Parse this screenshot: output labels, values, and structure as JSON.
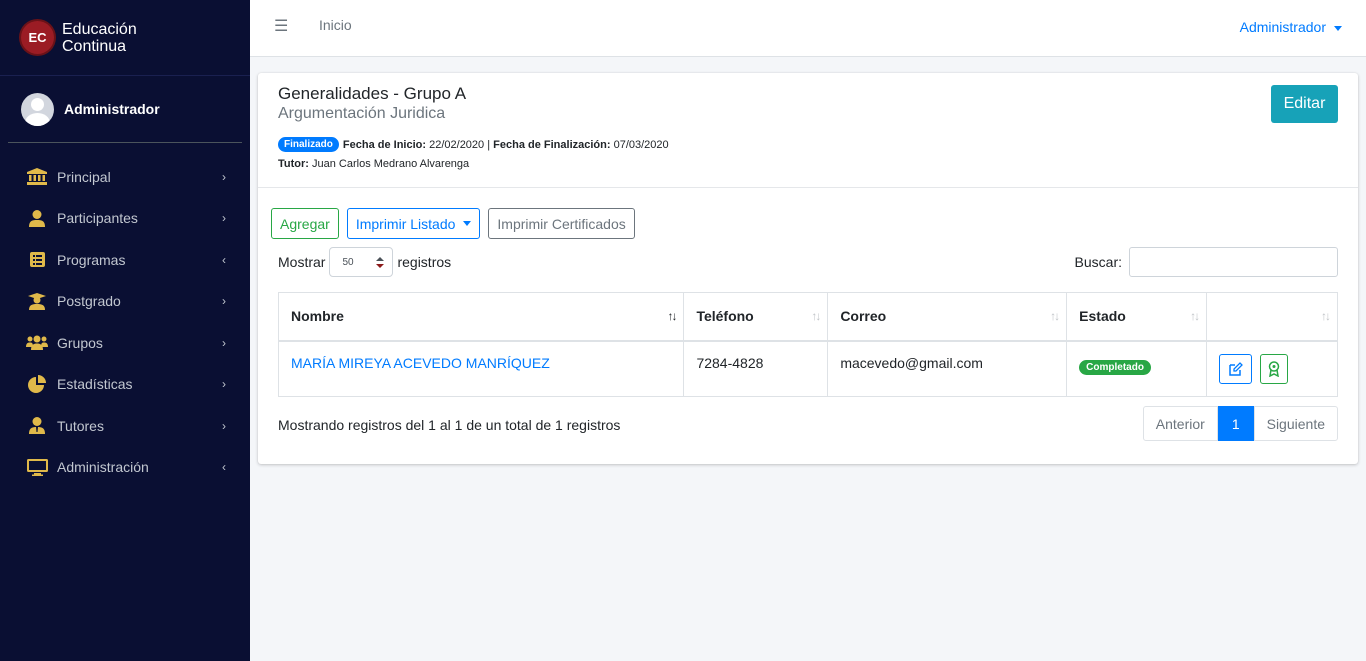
{
  "brand": {
    "logo_text": "EC",
    "line1": "Educación",
    "line2": "Continua"
  },
  "user": {
    "name": "Administrador"
  },
  "sidebar": {
    "items": [
      {
        "label": "Principal",
        "icon": "bank-icon",
        "arrow": "›"
      },
      {
        "label": "Participantes",
        "icon": "user-icon",
        "arrow": "›"
      },
      {
        "label": "Programas",
        "icon": "list-icon",
        "arrow": "‹"
      },
      {
        "label": "Postgrado",
        "icon": "graduate-icon",
        "arrow": "›"
      },
      {
        "label": "Grupos",
        "icon": "users-icon",
        "arrow": "›"
      },
      {
        "label": "Estadísticas",
        "icon": "pie-chart-icon",
        "arrow": "›"
      },
      {
        "label": "Tutores",
        "icon": "tutor-icon",
        "arrow": "›"
      },
      {
        "label": "Administración",
        "icon": "monitor-icon",
        "arrow": "‹"
      }
    ],
    "icon_color": "#e0b94a"
  },
  "navbar": {
    "hamburger": "☰",
    "inicio": "Inicio",
    "user_menu": "Administrador"
  },
  "card": {
    "title": "Generalidades - Grupo A",
    "subtitle": "Argumentación Juridica",
    "status_badge": "Finalizado",
    "start_label": "Fecha de Inicio:",
    "start_date": "22/02/2020",
    "separator": "|",
    "end_label": "Fecha de Finalización:",
    "end_date": "07/03/2020",
    "tutor_label": "Tutor:",
    "tutor_name": "Juan Carlos Medrano Alvarenga",
    "edit_button": "Editar"
  },
  "toolbar": {
    "add": "Agregar",
    "print_list": "Imprimir Listado",
    "print_certs": "Imprimir Certificados"
  },
  "length": {
    "prefix": "Mostrar",
    "value": "50",
    "suffix": "registros"
  },
  "search": {
    "label": "Buscar:",
    "value": ""
  },
  "table": {
    "headers": [
      "Nombre",
      "Teléfono",
      "Correo",
      "Estado",
      ""
    ],
    "rows": [
      {
        "name": "MARÍA MIREYA ACEVEDO MANRÍQUEZ",
        "phone": "7284-4828",
        "email": "macevedo@gmail.com",
        "status": "Completado"
      }
    ]
  },
  "footer": {
    "info": "Mostrando registros del 1 al 1 de un total de 1 registros",
    "prev": "Anterior",
    "page": "1",
    "next": "Siguiente"
  },
  "colors": {
    "sidebar_bg": "#0a0f33",
    "primary": "#007bff",
    "info": "#17a2b8",
    "success": "#28a745",
    "brand_logo": "#9b1c24"
  }
}
